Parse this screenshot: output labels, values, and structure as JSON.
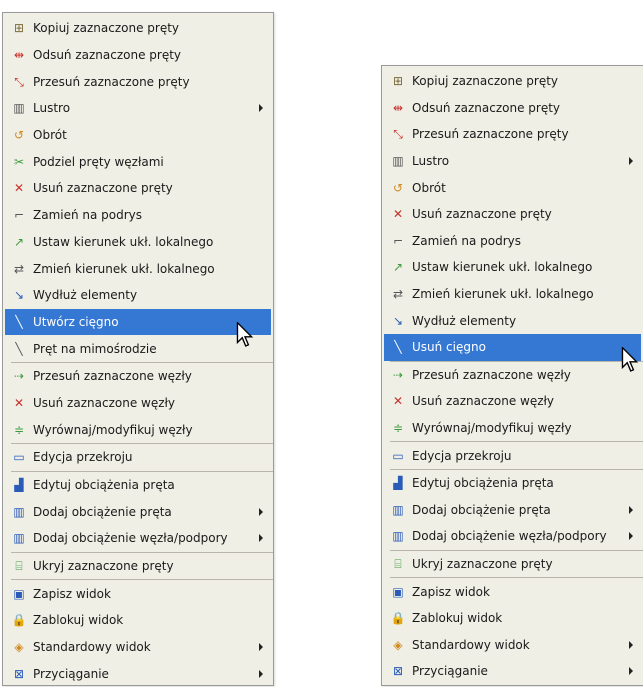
{
  "left_menu": {
    "items": [
      {
        "label": "Kopiuj zaznaczone pręty",
        "icon": "copy-bars-icon",
        "glyph": "⊞",
        "cls": "c-copy"
      },
      {
        "label": "Odsuń zaznaczone pręty",
        "icon": "offset-bars-icon",
        "glyph": "⇹",
        "cls": "c-red"
      },
      {
        "label": "Przesuń zaznaczone pręty",
        "icon": "move-bars-icon",
        "glyph": "⤡",
        "cls": "c-red"
      },
      {
        "label": "Lustro",
        "icon": "mirror-icon",
        "glyph": "▥",
        "cls": "c-gray",
        "submenu": true
      },
      {
        "label": "Obrót",
        "icon": "rotate-icon",
        "glyph": "↺",
        "cls": "c-orange"
      },
      {
        "label": "Podziel pręty węzłami",
        "icon": "divide-bars-icon",
        "glyph": "✂",
        "cls": "c-green"
      },
      {
        "label": "Usuń zaznaczone pręty",
        "icon": "delete-bars-icon",
        "glyph": "✕",
        "cls": "c-red"
      },
      {
        "label": "Zamień na podrys",
        "icon": "convert-underlay-icon",
        "glyph": "⌐",
        "cls": "c-gray"
      },
      {
        "label": "Ustaw kierunek ukł. lokalnego",
        "icon": "set-local-axis-icon",
        "glyph": "↗",
        "cls": "c-green"
      },
      {
        "label": "Zmień kierunek ukł. lokalnego",
        "icon": "change-local-axis-icon",
        "glyph": "⇄",
        "cls": "c-gray"
      },
      {
        "label": "Wydłuż elementy",
        "icon": "extend-elements-icon",
        "glyph": "↘",
        "cls": "c-blue"
      },
      {
        "label": "Utwórz cięgno",
        "icon": "create-cable-icon",
        "glyph": "╲",
        "cls": "c-gray",
        "highlighted": true
      },
      {
        "label": "Pręt na mimośrodzie",
        "icon": "eccentric-bar-icon",
        "glyph": "╲",
        "cls": "c-gray",
        "sep_after": true
      },
      {
        "label": "Przesuń zaznaczone węzły",
        "icon": "move-nodes-icon",
        "glyph": "⇢",
        "cls": "c-green"
      },
      {
        "label": "Usuń zaznaczone węzły",
        "icon": "delete-nodes-icon",
        "glyph": "✕",
        "cls": "c-red"
      },
      {
        "label": "Wyrównaj/modyfikuj węzły",
        "icon": "align-nodes-icon",
        "glyph": "≑",
        "cls": "c-green",
        "sep_after": true
      },
      {
        "label": "Edycja przekroju",
        "icon": "section-edit-icon",
        "glyph": "▭",
        "cls": "c-blue",
        "sep_after": true
      },
      {
        "label": "Edytuj obciążenia pręta",
        "icon": "edit-bar-loads-icon",
        "glyph": "▟",
        "cls": "c-blue"
      },
      {
        "label": "Dodaj obciążenie pręta",
        "icon": "add-bar-load-icon",
        "glyph": "▥",
        "cls": "c-blue",
        "submenu": true
      },
      {
        "label": "Dodaj obciążenie węzła/podpory",
        "icon": "add-node-load-icon",
        "glyph": "▥",
        "cls": "c-blue",
        "submenu": true,
        "sep_after": true
      },
      {
        "label": "Ukryj zaznaczone pręty",
        "icon": "hide-bars-icon",
        "glyph": "⌸",
        "cls": "c-green",
        "sep_after": true
      },
      {
        "label": "Zapisz widok",
        "icon": "save-view-icon",
        "glyph": "▣",
        "cls": "c-blue"
      },
      {
        "label": "Zablokuj widok",
        "icon": "lock-view-icon",
        "glyph": "🔒",
        "cls": "c-gray"
      },
      {
        "label": "Standardowy widok",
        "icon": "standard-view-icon",
        "glyph": "◈",
        "cls": "c-orange",
        "submenu": true
      },
      {
        "label": "Przyciąganie",
        "icon": "snapping-icon",
        "glyph": "⊠",
        "cls": "c-blue",
        "submenu": true
      }
    ]
  },
  "right_menu": {
    "items": [
      {
        "label": "Kopiuj zaznaczone pręty",
        "icon": "copy-bars-icon",
        "glyph": "⊞",
        "cls": "c-copy"
      },
      {
        "label": "Odsuń zaznaczone pręty",
        "icon": "offset-bars-icon",
        "glyph": "⇹",
        "cls": "c-red"
      },
      {
        "label": "Przesuń zaznaczone pręty",
        "icon": "move-bars-icon",
        "glyph": "⤡",
        "cls": "c-red"
      },
      {
        "label": "Lustro",
        "icon": "mirror-icon",
        "glyph": "▥",
        "cls": "c-gray",
        "submenu": true
      },
      {
        "label": "Obrót",
        "icon": "rotate-icon",
        "glyph": "↺",
        "cls": "c-orange"
      },
      {
        "label": "Usuń zaznaczone pręty",
        "icon": "delete-bars-icon",
        "glyph": "✕",
        "cls": "c-red"
      },
      {
        "label": "Zamień na podrys",
        "icon": "convert-underlay-icon",
        "glyph": "⌐",
        "cls": "c-gray"
      },
      {
        "label": "Ustaw kierunek ukł. lokalnego",
        "icon": "set-local-axis-icon",
        "glyph": "↗",
        "cls": "c-green"
      },
      {
        "label": "Zmień kierunek ukł. lokalnego",
        "icon": "change-local-axis-icon",
        "glyph": "⇄",
        "cls": "c-gray"
      },
      {
        "label": "Wydłuż elementy",
        "icon": "extend-elements-icon",
        "glyph": "↘",
        "cls": "c-blue"
      },
      {
        "label": "Usuń cięgno",
        "icon": "delete-cable-icon",
        "glyph": "╲",
        "cls": "c-red",
        "highlighted": true,
        "sep_after": true
      },
      {
        "label": "Przesuń zaznaczone węzły",
        "icon": "move-nodes-icon",
        "glyph": "⇢",
        "cls": "c-green"
      },
      {
        "label": "Usuń zaznaczone węzły",
        "icon": "delete-nodes-icon",
        "glyph": "✕",
        "cls": "c-red"
      },
      {
        "label": "Wyrównaj/modyfikuj węzły",
        "icon": "align-nodes-icon",
        "glyph": "≑",
        "cls": "c-green",
        "sep_after": true
      },
      {
        "label": "Edycja przekroju",
        "icon": "section-edit-icon",
        "glyph": "▭",
        "cls": "c-blue",
        "sep_after": true
      },
      {
        "label": "Edytuj obciążenia pręta",
        "icon": "edit-bar-loads-icon",
        "glyph": "▟",
        "cls": "c-blue"
      },
      {
        "label": "Dodaj obciążenie pręta",
        "icon": "add-bar-load-icon",
        "glyph": "▥",
        "cls": "c-blue",
        "submenu": true
      },
      {
        "label": "Dodaj obciążenie węzła/podpory",
        "icon": "add-node-load-icon",
        "glyph": "▥",
        "cls": "c-blue",
        "submenu": true,
        "sep_after": true
      },
      {
        "label": "Ukryj zaznaczone pręty",
        "icon": "hide-bars-icon",
        "glyph": "⌸",
        "cls": "c-green",
        "sep_after": true
      },
      {
        "label": "Zapisz widok",
        "icon": "save-view-icon",
        "glyph": "▣",
        "cls": "c-blue"
      },
      {
        "label": "Zablokuj widok",
        "icon": "lock-view-icon",
        "glyph": "🔒",
        "cls": "c-gray"
      },
      {
        "label": "Standardowy widok",
        "icon": "standard-view-icon",
        "glyph": "◈",
        "cls": "c-orange",
        "submenu": true
      },
      {
        "label": "Przyciąganie",
        "icon": "snapping-icon",
        "glyph": "⊠",
        "cls": "c-blue",
        "submenu": true
      }
    ]
  },
  "colors": {
    "menu_bg": "#f0efe6",
    "highlight": "#3578d4",
    "separator": "#b8b6a8"
  }
}
